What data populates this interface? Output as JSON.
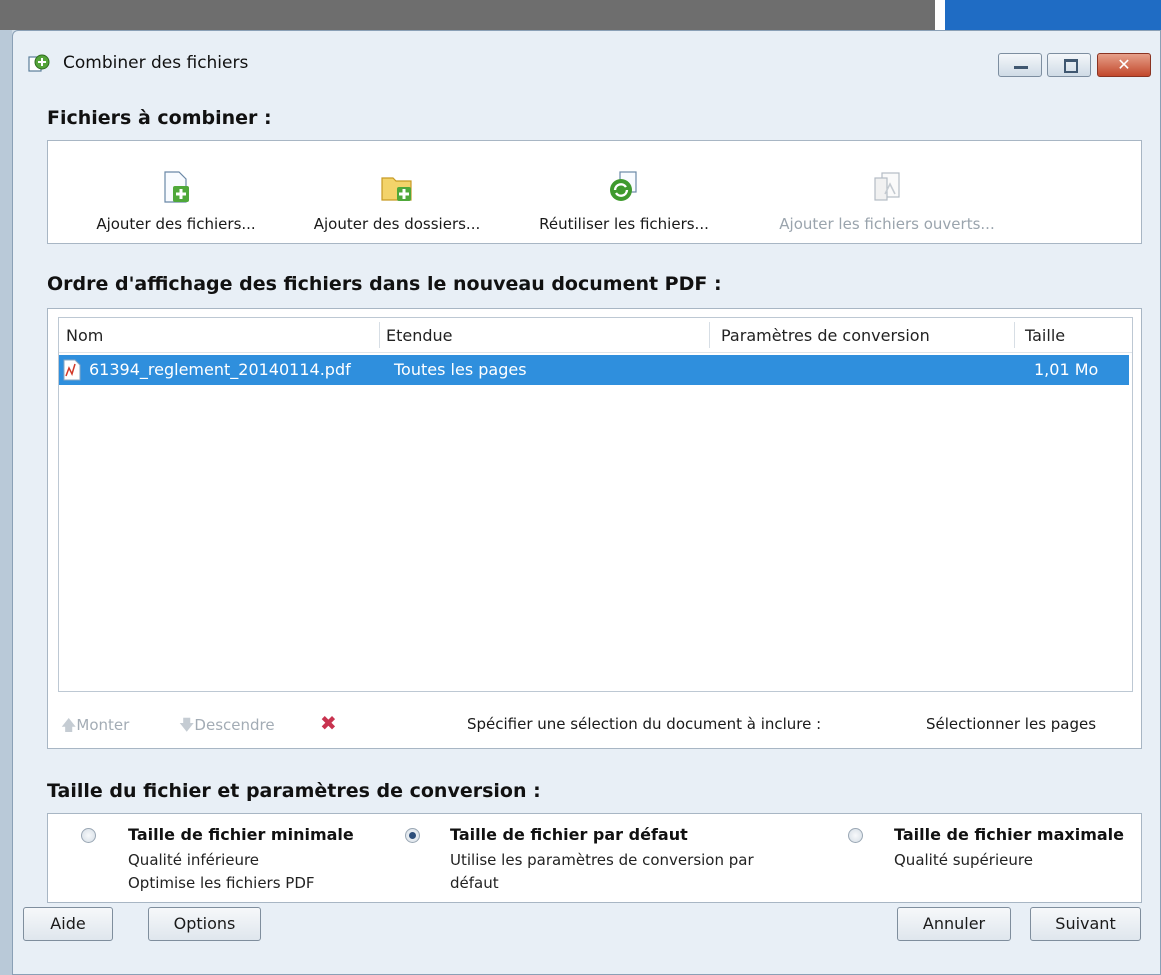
{
  "window": {
    "title": "Combiner des fichiers"
  },
  "sections": {
    "files_to_combine": "Fichiers à combiner :",
    "order": "Ordre d'affichage des fichiers dans le nouveau document PDF :",
    "size": "Taille du fichier et paramètres de conversion :"
  },
  "toolbar": {
    "add_files": "Ajouter des fichiers...",
    "add_folders": "Ajouter des dossiers...",
    "reuse_files": "Réutiliser les fichiers...",
    "add_open_files": "Ajouter les fichiers ouverts..."
  },
  "table": {
    "columns": [
      "Nom",
      "Etendue",
      "Paramètres de conversion",
      "Taille"
    ],
    "rows": [
      {
        "name": "61394_reglement_20140114.pdf",
        "range": "Toutes les pages",
        "conversion": "",
        "size": "1,01 Mo"
      }
    ]
  },
  "list_actions": {
    "move_up": "Monter",
    "move_down": "Descendre",
    "specify_label": "Spécifier une sélection du document à inclure :",
    "select_pages": "Sélectionner les pages"
  },
  "options": [
    {
      "title": "Taille de fichier minimale",
      "line1": "Qualité inférieure",
      "line2": "Optimise les fichiers PDF",
      "selected": false
    },
    {
      "title": "Taille de fichier par défaut",
      "line1": "Utilise les paramètres de conversion par",
      "line2": "défaut",
      "selected": true
    },
    {
      "title": "Taille de fichier maximale",
      "line1": "Qualité supérieure",
      "line2": "",
      "selected": false
    }
  ],
  "buttons": {
    "help": "Aide",
    "options": "Options",
    "cancel": "Annuler",
    "next": "Suivant"
  },
  "colors": {
    "selection": "#2f8fdd",
    "window_bg": "#e8eff6",
    "close_button": "#c2482c"
  }
}
